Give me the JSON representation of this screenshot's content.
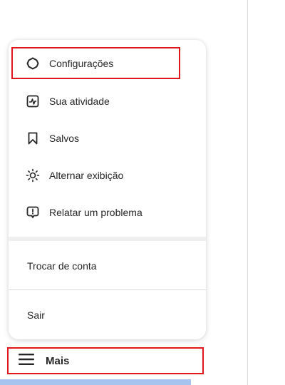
{
  "menu": {
    "items": [
      {
        "label": "Configurações",
        "icon": "settings-gear-icon"
      },
      {
        "label": "Sua atividade",
        "icon": "activity-chart-icon"
      },
      {
        "label": "Salvos",
        "icon": "bookmark-icon"
      },
      {
        "label": "Alternar exibição",
        "icon": "sun-icon"
      },
      {
        "label": "Relatar um problema",
        "icon": "report-problem-icon"
      }
    ],
    "switch_account": "Trocar de conta",
    "logout": "Sair"
  },
  "nav": {
    "more_label": "Mais",
    "more_icon": "hamburger-menu-icon"
  },
  "colors": {
    "highlight": "#e0161b",
    "text": "#262626",
    "selection_strip": "#a7c4ef"
  }
}
